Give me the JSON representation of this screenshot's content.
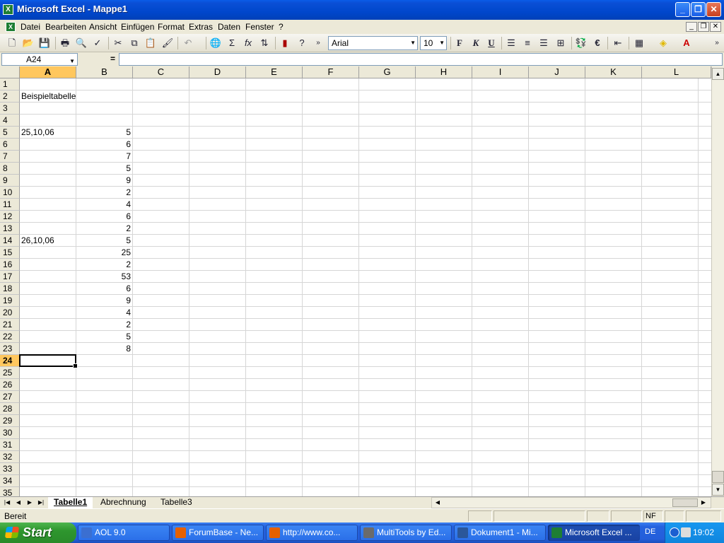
{
  "window": {
    "title": "Microsoft Excel - Mappe1",
    "min": "_",
    "restore": "❐",
    "close": "✕"
  },
  "menu": {
    "items": [
      "Datei",
      "Bearbeiten",
      "Ansicht",
      "Einfügen",
      "Format",
      "Extras",
      "Daten",
      "Fenster",
      "?"
    ],
    "doc_min": "_",
    "doc_restore": "❐",
    "doc_close": "✕"
  },
  "toolbar": {
    "font_name": "Arial",
    "font_size": "10",
    "bold": "F",
    "italic": "K",
    "underline": "U",
    "sum": "Σ",
    "fx": "fx",
    "euro": "€"
  },
  "formula_bar": {
    "name_box": "A24",
    "equals": "=",
    "content": ""
  },
  "sheet": {
    "columns": [
      "A",
      "B",
      "C",
      "D",
      "E",
      "F",
      "G",
      "H",
      "I",
      "J",
      "K",
      "L"
    ],
    "active_column": "A",
    "active_row": 24,
    "rows": [
      "1",
      "2",
      "3",
      "4",
      "5",
      "6",
      "7",
      "8",
      "9",
      "10",
      "11",
      "12",
      "13",
      "14",
      "15",
      "16",
      "17",
      "18",
      "19",
      "20",
      "21",
      "22",
      "23",
      "24",
      "25",
      "26",
      "27",
      "28",
      "29",
      "30",
      "31",
      "32",
      "33",
      "34",
      "35"
    ],
    "cells": [
      {
        "col": "A",
        "row": 2,
        "value": "Beispieltabelle",
        "type": "text"
      },
      {
        "col": "A",
        "row": 5,
        "value": "25,10,06",
        "type": "text"
      },
      {
        "col": "B",
        "row": 5,
        "value": "5",
        "type": "number"
      },
      {
        "col": "B",
        "row": 6,
        "value": "6",
        "type": "number"
      },
      {
        "col": "B",
        "row": 7,
        "value": "7",
        "type": "number"
      },
      {
        "col": "B",
        "row": 8,
        "value": "5",
        "type": "number"
      },
      {
        "col": "B",
        "row": 9,
        "value": "9",
        "type": "number"
      },
      {
        "col": "B",
        "row": 10,
        "value": "2",
        "type": "number"
      },
      {
        "col": "B",
        "row": 11,
        "value": "4",
        "type": "number"
      },
      {
        "col": "B",
        "row": 12,
        "value": "6",
        "type": "number"
      },
      {
        "col": "B",
        "row": 13,
        "value": "2",
        "type": "number"
      },
      {
        "col": "A",
        "row": 14,
        "value": "26,10,06",
        "type": "text"
      },
      {
        "col": "B",
        "row": 14,
        "value": "5",
        "type": "number"
      },
      {
        "col": "B",
        "row": 15,
        "value": "25",
        "type": "number"
      },
      {
        "col": "B",
        "row": 16,
        "value": "2",
        "type": "number"
      },
      {
        "col": "B",
        "row": 17,
        "value": "53",
        "type": "number"
      },
      {
        "col": "B",
        "row": 18,
        "value": "6",
        "type": "number"
      },
      {
        "col": "B",
        "row": 19,
        "value": "9",
        "type": "number"
      },
      {
        "col": "B",
        "row": 20,
        "value": "4",
        "type": "number"
      },
      {
        "col": "B",
        "row": 21,
        "value": "2",
        "type": "number"
      },
      {
        "col": "B",
        "row": 22,
        "value": "5",
        "type": "number"
      },
      {
        "col": "B",
        "row": 23,
        "value": "8",
        "type": "number"
      }
    ]
  },
  "tabs": {
    "items": [
      "Tabelle1",
      "Abrechnung",
      "Tabelle3"
    ],
    "active": "Tabelle1"
  },
  "status": {
    "text": "Bereit",
    "nf": "NF"
  },
  "taskbar": {
    "start": "Start",
    "tasks": [
      {
        "label": "AOL 9.0",
        "icon": "aol-icon",
        "color": "#3b6fd1"
      },
      {
        "label": "ForumBase - Ne...",
        "icon": "firefox-icon",
        "color": "#e66000"
      },
      {
        "label": "http://www.co...",
        "icon": "firefox-icon",
        "color": "#e66000"
      },
      {
        "label": "MultiTools by Ed...",
        "icon": "multitools-icon",
        "color": "#6b6b6b"
      },
      {
        "label": "Dokument1 - Mi...",
        "icon": "word-icon",
        "color": "#2b579a"
      },
      {
        "label": "Microsoft Excel ...",
        "icon": "excel-icon",
        "color": "#1e7e34"
      }
    ],
    "active_task": 5,
    "language": "DE",
    "clock": "19:02"
  }
}
